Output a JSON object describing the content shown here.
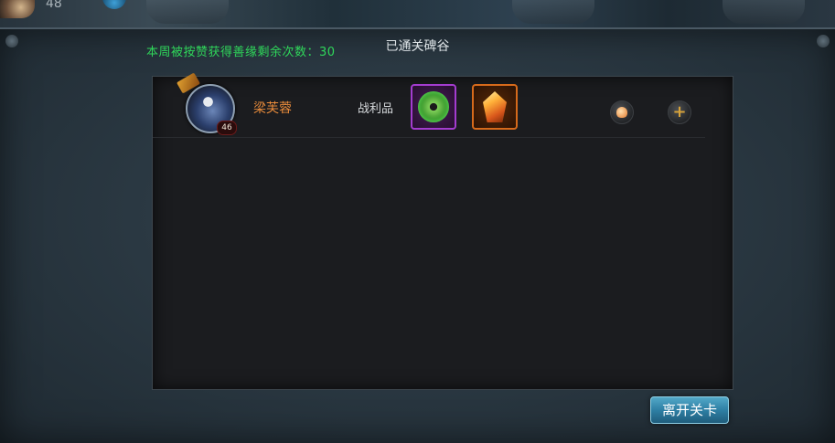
{
  "top": {
    "player_level": "48"
  },
  "panel": {
    "title": "已通关碑谷",
    "weekly_info": "本周被按赞获得善缘剩余次数：30"
  },
  "players": [
    {
      "name": "梁芙蓉",
      "level": "46",
      "loot_label": "战利品",
      "loot_items": [
        "jade-disc-icon",
        "amber-crystal-icon"
      ]
    }
  ],
  "buttons": {
    "leave": "离开关卡"
  },
  "colors": {
    "weekly_text": "#2fd65a",
    "player_name": "#ea8c3b",
    "epic_border": "#a43cd0",
    "legendary_border": "#d66a1b",
    "leave_button": "#2e7fa4"
  }
}
